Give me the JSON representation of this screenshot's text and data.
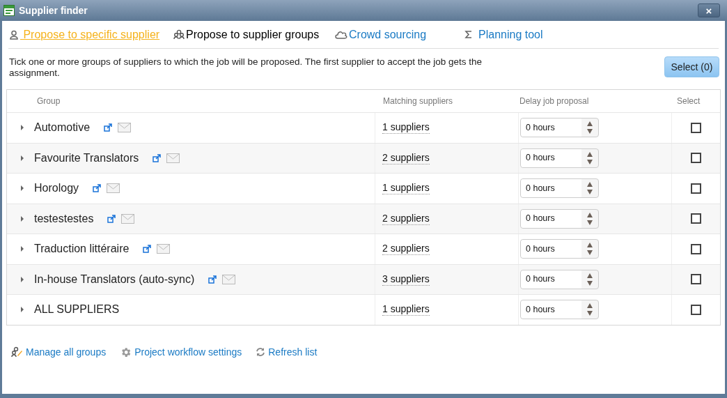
{
  "window": {
    "title": "Supplier finder",
    "close": "×"
  },
  "tabs": [
    {
      "label": " Propose to specific supplier",
      "kind": "person",
      "selected": false,
      "highlighted": true
    },
    {
      "label": "Propose to supplier groups",
      "kind": "group",
      "selected": true,
      "highlighted": false
    },
    {
      "label": "Crowd sourcing",
      "kind": "cloud",
      "selected": false,
      "highlighted": false
    },
    {
      "label": "Planning tool",
      "kind": "sigma",
      "selected": false,
      "highlighted": false
    }
  ],
  "description": "Tick one or more groups of suppliers to which the job will be proposed. The first supplier to accept the job gets the assignment.",
  "select_button": "Select (0)",
  "table": {
    "columns": [
      "Group",
      "Matching suppliers",
      "Delay job proposal",
      "Select"
    ],
    "rows": [
      {
        "group": "Automotive",
        "suppliers": "1 suppliers",
        "delay": "0 hours",
        "checked": false,
        "expanded": false,
        "actions": true
      },
      {
        "group": "Favourite Translators",
        "suppliers": "2 suppliers",
        "delay": "0 hours",
        "checked": false,
        "expanded": false,
        "actions": true
      },
      {
        "group": "Horology",
        "suppliers": "1 suppliers",
        "delay": "0 hours",
        "checked": false,
        "expanded": false,
        "actions": true
      },
      {
        "group": "testestestes",
        "suppliers": "2 suppliers",
        "delay": "0 hours",
        "checked": false,
        "expanded": false,
        "actions": true
      },
      {
        "group": "Traduction littéraire",
        "suppliers": "2 suppliers",
        "delay": "0 hours",
        "checked": false,
        "expanded": false,
        "actions": true
      },
      {
        "group": "In-house Translators (auto-sync)",
        "suppliers": "3 suppliers",
        "delay": "0 hours",
        "checked": false,
        "expanded": false,
        "actions": true
      },
      {
        "group": "ALL SUPPLIERS",
        "suppliers": "1 suppliers",
        "delay": "0 hours",
        "checked": false,
        "expanded": false,
        "actions": false
      }
    ]
  },
  "footer_links": [
    {
      "label": "Manage all groups",
      "kind": "group-edit"
    },
    {
      "label": "Project workflow settings",
      "kind": "gear"
    },
    {
      "label": "Refresh list",
      "kind": "refresh"
    }
  ]
}
